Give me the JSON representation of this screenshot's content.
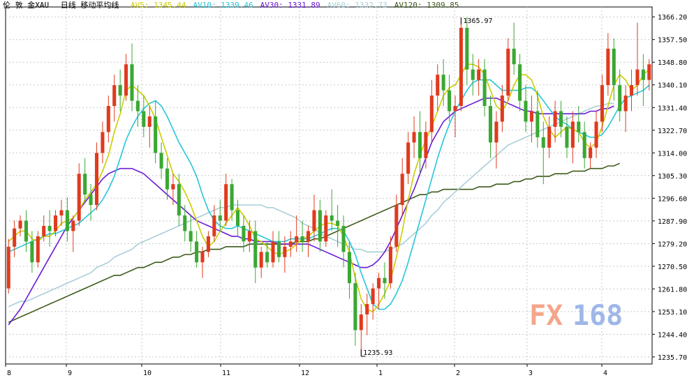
{
  "header": {
    "symbol": "伦 敦 金XAU",
    "period": "日线 移动平均线",
    "ma": [
      {
        "label": "AV5: 1345.44",
        "color": "#cccc00"
      },
      {
        "label": "AV10: 1339.46",
        "color": "#26c6d9"
      },
      {
        "label": "AV30: 1331.89",
        "color": "#6a1bd6"
      },
      {
        "label": "AV60: 1332.73",
        "color": "#a9cfd6"
      },
      {
        "label": "AV120: 1309.85",
        "color": "#3d5a1a"
      }
    ]
  },
  "watermark": {
    "text_a": "FX",
    "text_b": "168",
    "color_a": "#f4a58c",
    "color_b": "#9fb7e8"
  },
  "colors": {
    "up": "#e03a1e",
    "down": "#3aa832",
    "grid": "#c8c8c8",
    "axis": "#000000"
  },
  "chart_data": {
    "type": "candlestick",
    "ylim": [
      1233,
      1370
    ],
    "yticks": [
      "1366.20",
      "1357.50",
      "1348.80",
      "1340.10",
      "1331.40",
      "1322.70",
      "1314.00",
      "1305.30",
      "1296.60",
      "1287.90",
      "1279.20",
      "1270.50",
      "1261.80",
      "1253.10",
      "1244.40",
      "1235.70"
    ],
    "xticks": [
      "8",
      "9",
      "10",
      "11",
      "12",
      "1",
      "2",
      "3",
      "4"
    ],
    "annotations": [
      {
        "label": "1365.97",
        "value": 1365.97,
        "kind": "high"
      },
      {
        "label": "1235.93",
        "value": 1235.93,
        "kind": "low"
      }
    ],
    "candles": [
      [
        1262,
        1281,
        1260,
        1278
      ],
      [
        1278,
        1288,
        1274,
        1285
      ],
      [
        1285,
        1290,
        1282,
        1288
      ],
      [
        1288,
        1292,
        1276,
        1280
      ],
      [
        1280,
        1284,
        1268,
        1272
      ],
      [
        1272,
        1284,
        1270,
        1282
      ],
      [
        1282,
        1290,
        1280,
        1286
      ],
      [
        1286,
        1292,
        1278,
        1284
      ],
      [
        1284,
        1292,
        1282,
        1290
      ],
      [
        1290,
        1296,
        1286,
        1292
      ],
      [
        1292,
        1297,
        1280,
        1284
      ],
      [
        1284,
        1290,
        1276,
        1288
      ],
      [
        1288,
        1310,
        1286,
        1306
      ],
      [
        1306,
        1312,
        1295,
        1298
      ],
      [
        1298,
        1302,
        1288,
        1294
      ],
      [
        1294,
        1318,
        1292,
        1314
      ],
      [
        1314,
        1326,
        1310,
        1322
      ],
      [
        1322,
        1336,
        1318,
        1332
      ],
      [
        1332,
        1344,
        1326,
        1340
      ],
      [
        1340,
        1346,
        1330,
        1336
      ],
      [
        1336,
        1352,
        1334,
        1348
      ],
      [
        1348,
        1356,
        1330,
        1334
      ],
      [
        1334,
        1340,
        1324,
        1330
      ],
      [
        1330,
        1336,
        1320,
        1324
      ],
      [
        1324,
        1332,
        1316,
        1328
      ],
      [
        1328,
        1334,
        1310,
        1314
      ],
      [
        1314,
        1318,
        1304,
        1308
      ],
      [
        1308,
        1312,
        1296,
        1300
      ],
      [
        1300,
        1306,
        1294,
        1302
      ],
      [
        1302,
        1306,
        1286,
        1290
      ],
      [
        1290,
        1294,
        1280,
        1284
      ],
      [
        1284,
        1290,
        1276,
        1280
      ],
      [
        1280,
        1284,
        1270,
        1272
      ],
      [
        1272,
        1278,
        1266,
        1276
      ],
      [
        1276,
        1284,
        1274,
        1282
      ],
      [
        1282,
        1294,
        1280,
        1290
      ],
      [
        1290,
        1296,
        1284,
        1288
      ],
      [
        1288,
        1306,
        1286,
        1302
      ],
      [
        1302,
        1304,
        1288,
        1292
      ],
      [
        1292,
        1296,
        1282,
        1286
      ],
      [
        1286,
        1290,
        1276,
        1280
      ],
      [
        1280,
        1288,
        1276,
        1284
      ],
      [
        1284,
        1288,
        1264,
        1270
      ],
      [
        1270,
        1278,
        1266,
        1276
      ],
      [
        1276,
        1280,
        1270,
        1272
      ],
      [
        1272,
        1284,
        1270,
        1280
      ],
      [
        1280,
        1284,
        1272,
        1274
      ],
      [
        1274,
        1282,
        1268,
        1278
      ],
      [
        1278,
        1284,
        1274,
        1280
      ],
      [
        1280,
        1290,
        1276,
        1282
      ],
      [
        1282,
        1288,
        1276,
        1280
      ],
      [
        1280,
        1286,
        1274,
        1284
      ],
      [
        1284,
        1298,
        1280,
        1292
      ],
      [
        1292,
        1296,
        1276,
        1280
      ],
      [
        1280,
        1292,
        1278,
        1290
      ],
      [
        1290,
        1300,
        1284,
        1288
      ],
      [
        1288,
        1294,
        1278,
        1286
      ],
      [
        1286,
        1290,
        1270,
        1276
      ],
      [
        1276,
        1280,
        1258,
        1264
      ],
      [
        1264,
        1268,
        1240,
        1246
      ],
      [
        1246,
        1256,
        1236,
        1252
      ],
      [
        1252,
        1260,
        1244,
        1256
      ],
      [
        1256,
        1264,
        1250,
        1262
      ],
      [
        1262,
        1268,
        1254,
        1266
      ],
      [
        1266,
        1272,
        1258,
        1264
      ],
      [
        1264,
        1282,
        1262,
        1278
      ],
      [
        1278,
        1298,
        1276,
        1294
      ],
      [
        1294,
        1312,
        1290,
        1306
      ],
      [
        1306,
        1322,
        1302,
        1318
      ],
      [
        1318,
        1328,
        1312,
        1322
      ],
      [
        1322,
        1330,
        1306,
        1312
      ],
      [
        1312,
        1326,
        1308,
        1322
      ],
      [
        1322,
        1342,
        1318,
        1336
      ],
      [
        1336,
        1348,
        1330,
        1344
      ],
      [
        1344,
        1350,
        1332,
        1338
      ],
      [
        1338,
        1344,
        1326,
        1330
      ],
      [
        1330,
        1336,
        1320,
        1332
      ],
      [
        1332,
        1366,
        1330,
        1362
      ],
      [
        1362,
        1366,
        1340,
        1346
      ],
      [
        1346,
        1352,
        1336,
        1342
      ],
      [
        1342,
        1350,
        1336,
        1346
      ],
      [
        1346,
        1350,
        1328,
        1332
      ],
      [
        1332,
        1336,
        1312,
        1318
      ],
      [
        1318,
        1330,
        1308,
        1326
      ],
      [
        1326,
        1340,
        1322,
        1336
      ],
      [
        1336,
        1358,
        1334,
        1354
      ],
      [
        1354,
        1364,
        1344,
        1348
      ],
      [
        1348,
        1352,
        1330,
        1334
      ],
      [
        1334,
        1340,
        1322,
        1326
      ],
      [
        1326,
        1336,
        1318,
        1330
      ],
      [
        1330,
        1338,
        1316,
        1320
      ],
      [
        1320,
        1326,
        1302,
        1316
      ],
      [
        1316,
        1328,
        1312,
        1324
      ],
      [
        1324,
        1334,
        1318,
        1330
      ],
      [
        1330,
        1334,
        1320,
        1324
      ],
      [
        1324,
        1328,
        1312,
        1316
      ],
      [
        1316,
        1330,
        1310,
        1326
      ],
      [
        1326,
        1332,
        1318,
        1322
      ],
      [
        1322,
        1326,
        1308,
        1312
      ],
      [
        1312,
        1318,
        1308,
        1316
      ],
      [
        1316,
        1330,
        1312,
        1326
      ],
      [
        1326,
        1344,
        1322,
        1340
      ],
      [
        1340,
        1360,
        1336,
        1354
      ],
      [
        1354,
        1358,
        1334,
        1340
      ],
      [
        1340,
        1346,
        1326,
        1330
      ],
      [
        1330,
        1340,
        1322,
        1336
      ],
      [
        1336,
        1346,
        1330,
        1340
      ],
      [
        1340,
        1364,
        1336,
        1346
      ],
      [
        1346,
        1352,
        1332,
        1342
      ],
      [
        1342,
        1350,
        1338,
        1348
      ]
    ],
    "ma5": [
      1280,
      1282,
      1284,
      1284,
      1281,
      1280,
      1282,
      1282,
      1284,
      1287,
      1288,
      1289,
      1292,
      1296,
      1299,
      1302,
      1307,
      1313,
      1322,
      1329,
      1338,
      1340,
      1338,
      1336,
      1332,
      1327,
      1320,
      1313,
      1306,
      1303,
      1299,
      1294,
      1288,
      1282,
      1278,
      1280,
      1284,
      1287,
      1290,
      1293,
      1290,
      1286,
      1281,
      1280,
      1278,
      1276,
      1275,
      1276,
      1277,
      1279,
      1281,
      1282,
      1284,
      1286,
      1287,
      1287,
      1286,
      1282,
      1276,
      1266,
      1258,
      1254,
      1253,
      1256,
      1260,
      1265,
      1274,
      1284,
      1296,
      1306,
      1313,
      1319,
      1324,
      1330,
      1336,
      1339,
      1340,
      1344,
      1348,
      1348,
      1347,
      1344,
      1338,
      1332,
      1330,
      1334,
      1340,
      1344,
      1344,
      1342,
      1336,
      1328,
      1323,
      1320,
      1322,
      1324,
      1323,
      1322,
      1318,
      1316,
      1318,
      1324,
      1332,
      1340,
      1344,
      1342,
      1338,
      1340,
      1344,
      1346
    ],
    "ma10": [
      1276,
      1277,
      1278,
      1279,
      1280,
      1281,
      1282,
      1283,
      1283,
      1284,
      1285,
      1286,
      1287,
      1289,
      1291,
      1293,
      1296,
      1300,
      1305,
      1312,
      1319,
      1324,
      1328,
      1331,
      1333,
      1334,
      1332,
      1328,
      1323,
      1318,
      1314,
      1310,
      1305,
      1298,
      1292,
      1288,
      1286,
      1285,
      1285,
      1286,
      1285,
      1284,
      1283,
      1282,
      1281,
      1280,
      1280,
      1280,
      1281,
      1281,
      1281,
      1281,
      1282,
      1283,
      1284,
      1285,
      1285,
      1284,
      1280,
      1275,
      1268,
      1262,
      1256,
      1254,
      1254,
      1256,
      1260,
      1265,
      1272,
      1280,
      1288,
      1296,
      1304,
      1312,
      1319,
      1325,
      1330,
      1334,
      1338,
      1341,
      1342,
      1342,
      1342,
      1340,
      1338,
      1338,
      1338,
      1338,
      1339,
      1339,
      1337,
      1334,
      1331,
      1328,
      1326,
      1325,
      1323,
      1322,
      1321,
      1320,
      1320,
      1321,
      1324,
      1328,
      1332,
      1335,
      1336,
      1337,
      1338,
      1340
    ],
    "ma30": [
      1248,
      1251,
      1254,
      1258,
      1262,
      1266,
      1270,
      1274,
      1278,
      1282,
      1286,
      1289,
      1292,
      1295,
      1298,
      1301,
      1304,
      1306,
      1307,
      1308,
      1308,
      1308,
      1307,
      1306,
      1304,
      1302,
      1300,
      1298,
      1296,
      1294,
      1292,
      1290,
      1288,
      1287,
      1286,
      1285,
      1284,
      1283,
      1282,
      1282,
      1281,
      1281,
      1280,
      1280,
      1280,
      1280,
      1279,
      1279,
      1279,
      1279,
      1279,
      1279,
      1278,
      1277,
      1276,
      1275,
      1274,
      1273,
      1272,
      1271,
      1270,
      1270,
      1271,
      1273,
      1276,
      1280,
      1285,
      1290,
      1295,
      1300,
      1306,
      1312,
      1318,
      1322,
      1326,
      1328,
      1330,
      1331,
      1332,
      1333,
      1334,
      1335,
      1335,
      1335,
      1334,
      1333,
      1332,
      1331,
      1330,
      1330,
      1329,
      1329,
      1329,
      1329,
      1329,
      1329,
      1329,
      1329,
      1329,
      1330,
      1330,
      1331,
      1331,
      1332
    ],
    "ma60": [
      1255,
      1256,
      1257,
      1257,
      1258,
      1259,
      1260,
      1261,
      1262,
      1263,
      1264,
      1265,
      1266,
      1267,
      1268,
      1270,
      1271,
      1272,
      1274,
      1275,
      1276,
      1277,
      1279,
      1280,
      1281,
      1282,
      1283,
      1284,
      1285,
      1286,
      1287,
      1288,
      1289,
      1290,
      1291,
      1292,
      1293,
      1293,
      1294,
      1294,
      1294,
      1294,
      1294,
      1294,
      1293,
      1293,
      1292,
      1291,
      1290,
      1289,
      1287,
      1286,
      1285,
      1283,
      1282,
      1281,
      1280,
      1279,
      1278,
      1277,
      1277,
      1276,
      1276,
      1276,
      1276,
      1277,
      1278,
      1279,
      1281,
      1283,
      1285,
      1287,
      1290,
      1292,
      1295,
      1297,
      1299,
      1301,
      1303,
      1305,
      1307,
      1309,
      1311,
      1313,
      1315,
      1317,
      1318,
      1319,
      1320,
      1321,
      1322,
      1323,
      1324,
      1325,
      1326,
      1327,
      1328,
      1329,
      1330,
      1331,
      1332,
      1332,
      1333,
      1333
    ],
    "ma120": [
      1249,
      1250,
      1251,
      1252,
      1253,
      1254,
      1255,
      1256,
      1257,
      1258,
      1259,
      1260,
      1261,
      1262,
      1263,
      1264,
      1265,
      1266,
      1267,
      1267,
      1268,
      1269,
      1270,
      1270,
      1271,
      1272,
      1272,
      1273,
      1274,
      1274,
      1275,
      1275,
      1276,
      1276,
      1277,
      1277,
      1277,
      1278,
      1278,
      1278,
      1278,
      1279,
      1279,
      1279,
      1279,
      1279,
      1279,
      1279,
      1279,
      1280,
      1280,
      1280,
      1281,
      1281,
      1282,
      1283,
      1284,
      1285,
      1286,
      1287,
      1288,
      1289,
      1290,
      1291,
      1292,
      1293,
      1294,
      1295,
      1296,
      1297,
      1298,
      1298,
      1299,
      1299,
      1300,
      1300,
      1300,
      1300,
      1300,
      1300,
      1301,
      1301,
      1301,
      1302,
      1302,
      1302,
      1303,
      1303,
      1304,
      1304,
      1305,
      1305,
      1305,
      1306,
      1306,
      1306,
      1307,
      1307,
      1307,
      1308,
      1308,
      1308,
      1309,
      1309,
      1310
    ]
  }
}
